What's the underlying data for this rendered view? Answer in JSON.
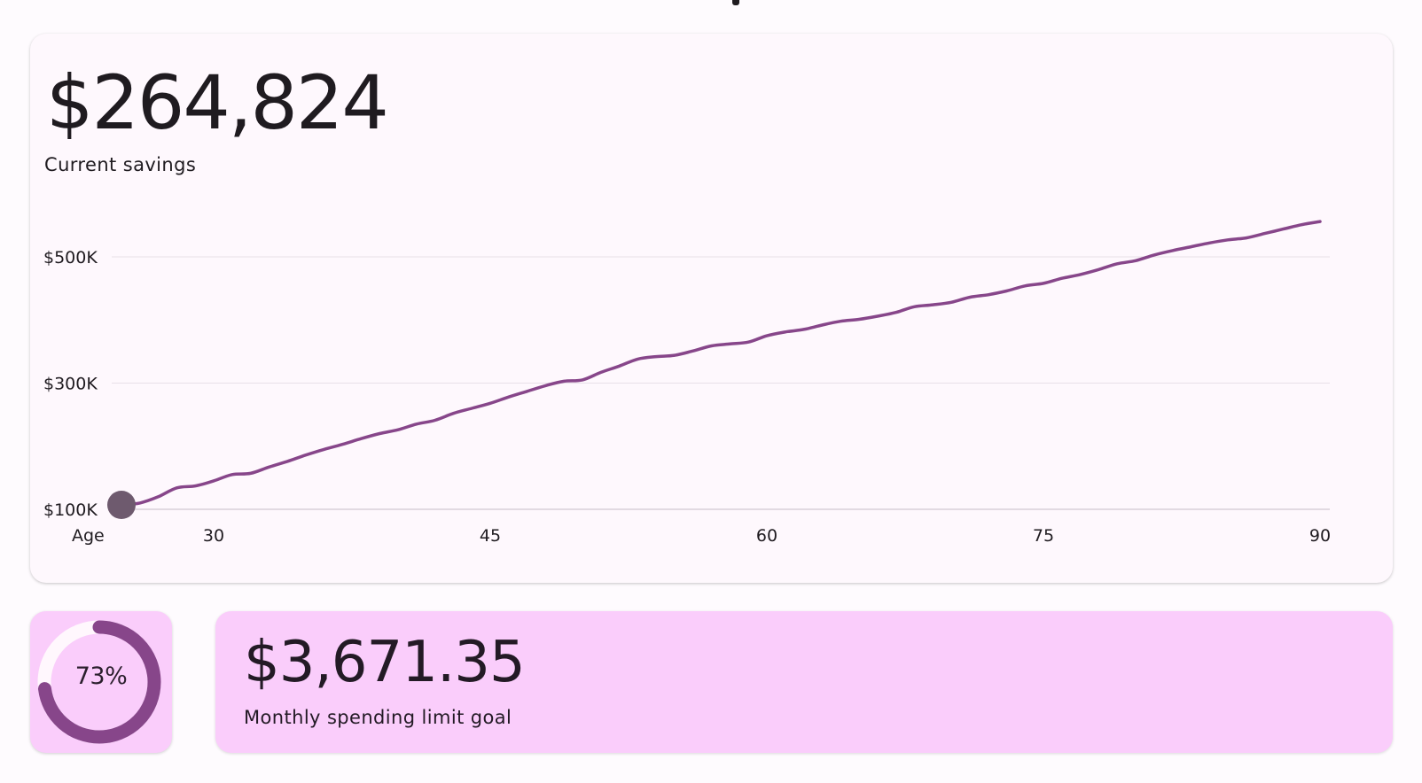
{
  "savings": {
    "amount": "$264,824",
    "label": "Current savings"
  },
  "colors": {
    "accent": "#87468a",
    "marker": "#6e5a6e",
    "card_background": "#fef8fd",
    "goal_card_background": "#facdfb",
    "gridline": "#e8e0e8"
  },
  "chart_data": {
    "type": "line",
    "xlabel": "Age",
    "ylabel": "",
    "x_ticks": [
      30,
      45,
      60,
      75,
      90
    ],
    "y_ticks": [
      "$100K",
      "$300K",
      "$500K"
    ],
    "y_tick_values": [
      100000,
      300000,
      500000
    ],
    "xlim": [
      25,
      90
    ],
    "ylim": [
      100000,
      500000
    ],
    "grid": "horizontal",
    "marker_point": {
      "x": 25,
      "y": 107000
    },
    "series": [
      {
        "x": [
          25,
          26,
          27,
          28,
          29,
          30,
          31,
          32,
          33,
          34,
          35,
          36,
          37,
          38,
          39,
          40,
          41,
          42,
          43,
          44,
          45,
          46,
          47,
          48,
          49,
          50,
          51,
          52,
          53,
          54,
          55,
          56,
          57,
          58,
          59,
          60,
          61,
          62,
          63,
          64,
          65,
          66,
          67,
          68,
          69,
          70,
          71,
          72,
          73,
          74,
          75,
          76,
          77,
          78,
          79,
          80,
          81,
          82,
          83,
          84,
          85,
          86,
          87,
          88,
          89,
          90
        ],
        "y": [
          107000,
          110000,
          120000,
          134000,
          137000,
          145000,
          155000,
          157000,
          167000,
          176000,
          186000,
          195000,
          203000,
          212000,
          220000,
          226000,
          235000,
          241000,
          252000,
          260000,
          268000,
          278000,
          287000,
          296000,
          303000,
          305000,
          317000,
          327000,
          338000,
          342000,
          344000,
          351000,
          359000,
          362000,
          365000,
          375000,
          381000,
          385000,
          392000,
          398000,
          401000,
          406000,
          412000,
          421000,
          424000,
          428000,
          436000,
          440000,
          446000,
          454000,
          458000,
          466000,
          472000,
          480000,
          489000,
          494000,
          503000,
          510000,
          516000,
          522000,
          527000,
          530000,
          537000,
          544000,
          551000,
          556000
        ]
      }
    ]
  },
  "spending": {
    "progress_percent": 73,
    "progress_label": "73%",
    "goal_amount": "$3,671.35",
    "goal_label": "Monthly spending limit goal"
  }
}
